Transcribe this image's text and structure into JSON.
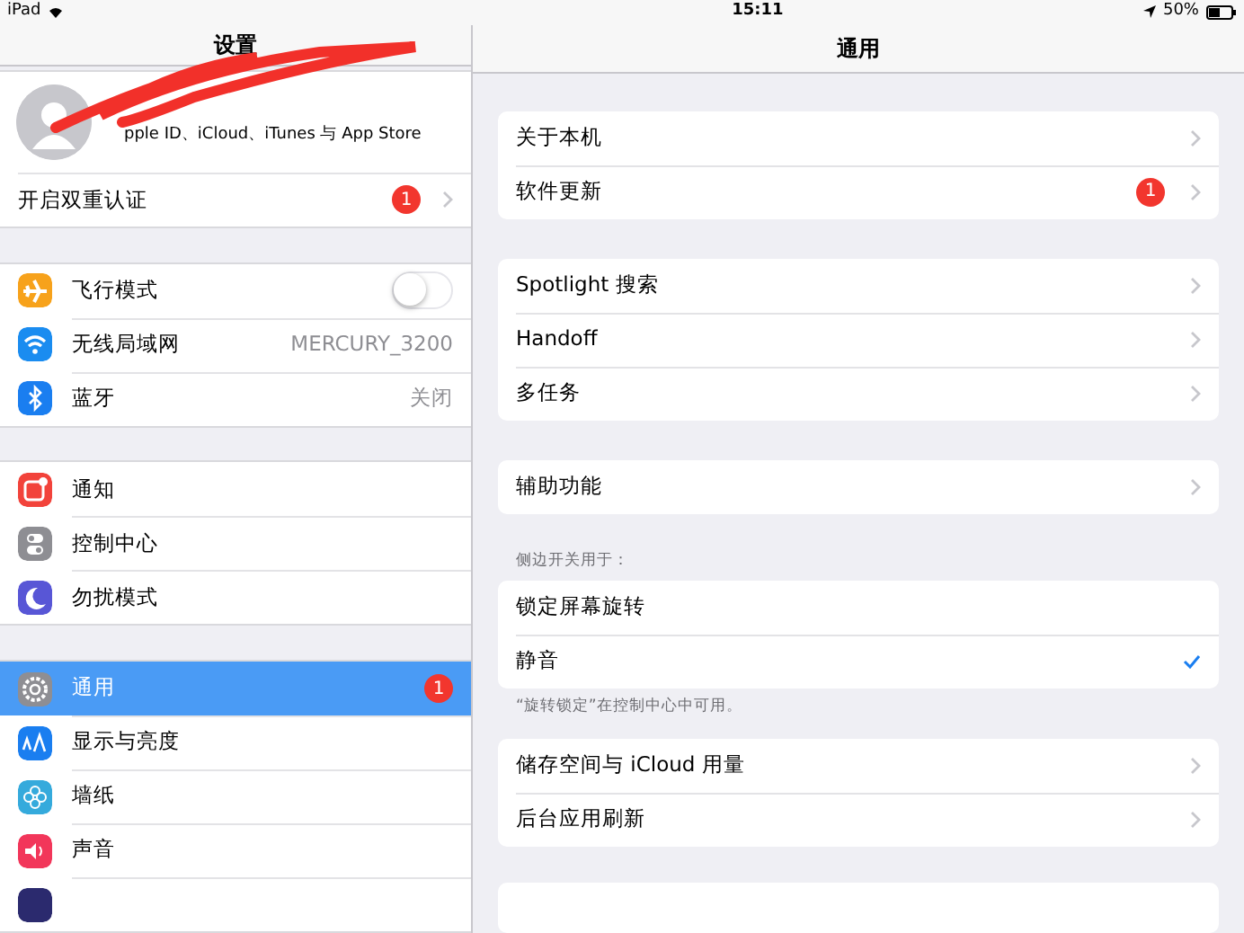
{
  "status_bar": {
    "device": "iPad",
    "time": "15:11",
    "battery": "50%"
  },
  "sidebar": {
    "title": "设置",
    "profile": {
      "subtitle": "pple ID、iCloud、iTunes 与 App Store"
    },
    "groups": [
      [
        {
          "label": "开启双重认证",
          "kind": "link",
          "badge": "1",
          "selected": false
        }
      ],
      [
        {
          "label": "飞行模式",
          "kind": "toggle",
          "on": false,
          "color": "#f7a21b",
          "selected": false
        },
        {
          "label": "无线局域网",
          "kind": "value",
          "value": "MERCURY_3200",
          "color": "#1a8cf0",
          "selected": false
        },
        {
          "label": "蓝牙",
          "kind": "value",
          "value": "关闭",
          "color": "#1a7ef0",
          "selected": false
        }
      ],
      [
        {
          "label": "通知",
          "kind": "plain",
          "color": "#f2433b",
          "selected": false
        },
        {
          "label": "控制中心",
          "kind": "plain",
          "color": "#8e8e93",
          "selected": false
        },
        {
          "label": "勿扰模式",
          "kind": "plain",
          "color": "#5856d6",
          "selected": false
        }
      ],
      [
        {
          "label": "通用",
          "kind": "plain",
          "badge": "1",
          "color": "#8e8e93",
          "selected": true
        },
        {
          "label": "显示与亮度",
          "kind": "plain",
          "color": "#1a7ef0",
          "selected": false
        },
        {
          "label": "墙纸",
          "kind": "plain",
          "color": "#35aadc",
          "selected": false
        },
        {
          "label": "声音",
          "kind": "plain",
          "color": "#f2365a",
          "selected": false
        },
        {
          "kind": "plain",
          "color": "#2b2a6e",
          "selected": false
        }
      ]
    ]
  },
  "detail": {
    "title": "通用",
    "sections": [
      {
        "rows": [
          {
            "label": "关于本机",
            "kind": "link"
          },
          {
            "label": "软件更新",
            "kind": "link",
            "badge": "1"
          }
        ]
      },
      {
        "rows": [
          {
            "label": "Spotlight 搜索",
            "kind": "link"
          },
          {
            "label": "Handoff",
            "kind": "link"
          },
          {
            "label": "多任务",
            "kind": "link"
          }
        ]
      },
      {
        "rows": [
          {
            "label": "辅助功能",
            "kind": "link"
          }
        ]
      },
      {
        "header": "侧边开关用于：",
        "footer": "“旋转锁定”在控制中心中可用。",
        "rows": [
          {
            "label": "锁定屏幕旋转",
            "kind": "check",
            "checked": false
          },
          {
            "label": "静音",
            "kind": "check",
            "checked": true
          }
        ]
      },
      {
        "rows": [
          {
            "label": "储存空间与 iCloud 用量",
            "kind": "link"
          },
          {
            "label": "后台应用刷新",
            "kind": "link"
          }
        ]
      }
    ]
  }
}
